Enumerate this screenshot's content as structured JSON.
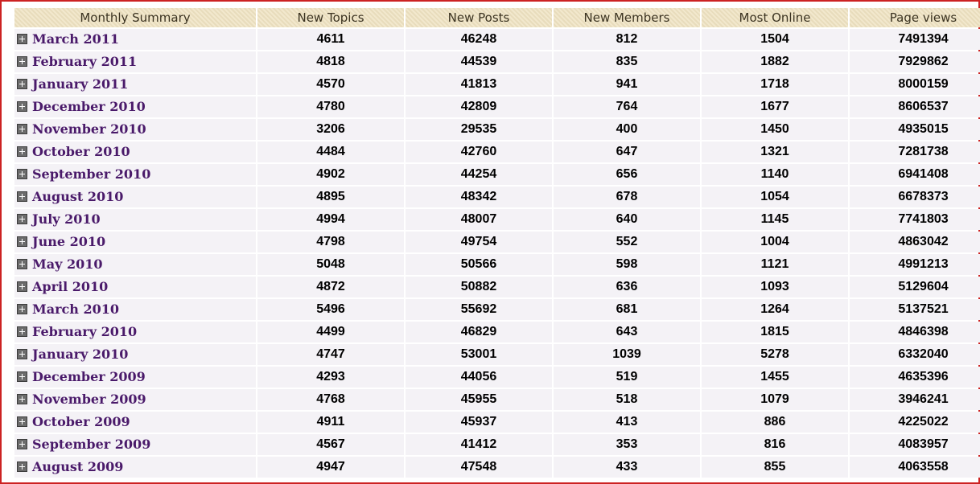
{
  "headers": [
    "Monthly Summary",
    "New Topics",
    "New Posts",
    "New Members",
    "Most Online",
    "Page views"
  ],
  "rows": [
    {
      "month": "March 2011",
      "topics": "4611",
      "posts": "46248",
      "members": "812",
      "online": "1504",
      "views": "7491394"
    },
    {
      "month": "February 2011",
      "topics": "4818",
      "posts": "44539",
      "members": "835",
      "online": "1882",
      "views": "7929862"
    },
    {
      "month": "January 2011",
      "topics": "4570",
      "posts": "41813",
      "members": "941",
      "online": "1718",
      "views": "8000159"
    },
    {
      "month": "December 2010",
      "topics": "4780",
      "posts": "42809",
      "members": "764",
      "online": "1677",
      "views": "8606537"
    },
    {
      "month": "November 2010",
      "topics": "3206",
      "posts": "29535",
      "members": "400",
      "online": "1450",
      "views": "4935015"
    },
    {
      "month": "October 2010",
      "topics": "4484",
      "posts": "42760",
      "members": "647",
      "online": "1321",
      "views": "7281738"
    },
    {
      "month": "September 2010",
      "topics": "4902",
      "posts": "44254",
      "members": "656",
      "online": "1140",
      "views": "6941408"
    },
    {
      "month": "August 2010",
      "topics": "4895",
      "posts": "48342",
      "members": "678",
      "online": "1054",
      "views": "6678373"
    },
    {
      "month": "July 2010",
      "topics": "4994",
      "posts": "48007",
      "members": "640",
      "online": "1145",
      "views": "7741803"
    },
    {
      "month": "June 2010",
      "topics": "4798",
      "posts": "49754",
      "members": "552",
      "online": "1004",
      "views": "4863042"
    },
    {
      "month": "May 2010",
      "topics": "5048",
      "posts": "50566",
      "members": "598",
      "online": "1121",
      "views": "4991213"
    },
    {
      "month": "April 2010",
      "topics": "4872",
      "posts": "50882",
      "members": "636",
      "online": "1093",
      "views": "5129604"
    },
    {
      "month": "March 2010",
      "topics": "5496",
      "posts": "55692",
      "members": "681",
      "online": "1264",
      "views": "5137521"
    },
    {
      "month": "February 2010",
      "topics": "4499",
      "posts": "46829",
      "members": "643",
      "online": "1815",
      "views": "4846398"
    },
    {
      "month": "January 2010",
      "topics": "4747",
      "posts": "53001",
      "members": "1039",
      "online": "5278",
      "views": "6332040"
    },
    {
      "month": "December 2009",
      "topics": "4293",
      "posts": "44056",
      "members": "519",
      "online": "1455",
      "views": "4635396"
    },
    {
      "month": "November 2009",
      "topics": "4768",
      "posts": "45955",
      "members": "518",
      "online": "1079",
      "views": "3946241"
    },
    {
      "month": "October 2009",
      "topics": "4911",
      "posts": "45937",
      "members": "413",
      "online": "886",
      "views": "4225022"
    },
    {
      "month": "September 2009",
      "topics": "4567",
      "posts": "41412",
      "members": "353",
      "online": "816",
      "views": "4083957"
    },
    {
      "month": "August 2009",
      "topics": "4947",
      "posts": "47548",
      "members": "433",
      "online": "855",
      "views": "4063558"
    }
  ],
  "icons": {
    "expand": "plus-square-icon"
  },
  "colors": {
    "header_bg": "#efe3c2",
    "row_bg": "#f4f2f6",
    "link": "#4a1a6a",
    "border": "#cc2222"
  }
}
